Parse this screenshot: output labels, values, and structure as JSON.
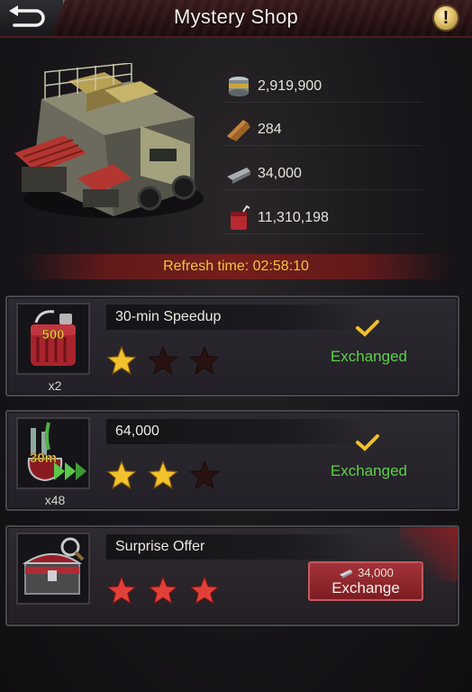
{
  "header": {
    "title": "Mystery Shop",
    "info_label": "!"
  },
  "resources": [
    {
      "icon": "food-can-icon",
      "value": "2,919,900"
    },
    {
      "icon": "wood-planks-icon",
      "value": "284"
    },
    {
      "icon": "steel-bar-icon",
      "value": "34,000"
    },
    {
      "icon": "oil-can-icon",
      "value": "11,310,198"
    }
  ],
  "refresh": {
    "text": "Refresh time: 02:58:10"
  },
  "items": [
    {
      "name": "30-min Speedup",
      "thumb_icon": "fuel-canister-icon",
      "thumb_label": "500",
      "quantity": "x2",
      "stars": 1,
      "stars_max": 3,
      "status": "Exchanged"
    },
    {
      "name": "64,000",
      "thumb_icon": "speedup-potion-icon",
      "thumb_label": "30m",
      "quantity": "x48",
      "stars": 2,
      "stars_max": 3,
      "status": "Exchanged"
    },
    {
      "name": "Surprise Offer",
      "thumb_icon": "treasure-chest-icon",
      "thumb_label": "",
      "quantity": "",
      "stars": 3,
      "stars_max": 3,
      "cost_icon": "steel-bar-icon",
      "cost": "34,000",
      "button_label": "Exchange"
    }
  ],
  "colors": {
    "exchanged": "#5fcf4a",
    "refresh_text": "#f4c43c",
    "star_gold": "#f2c12e",
    "star_red": "#e2413a",
    "star_empty": "#2a1212"
  }
}
